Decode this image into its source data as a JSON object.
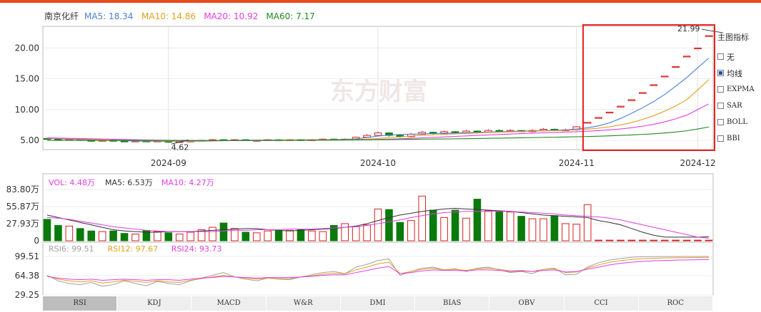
{
  "stock": {
    "name": "南京化纤",
    "ma": [
      {
        "label": "MA5: 18.34",
        "color": "#4a7fd6"
      },
      {
        "label": "MA10: 14.86",
        "color": "#e0a020"
      },
      {
        "label": "MA20: 10.92",
        "color": "#e23de2"
      },
      {
        "label": "MA60: 7.17",
        "color": "#1f8a1f"
      }
    ]
  },
  "watermark": "东方财富",
  "indicator_panel": {
    "title": "主图指标",
    "options": [
      {
        "label": "无",
        "checked": false
      },
      {
        "label": "均线",
        "checked": true
      },
      {
        "label": "EXPMA",
        "checked": false
      },
      {
        "label": "SAR",
        "checked": false
      },
      {
        "label": "BOLL",
        "checked": false
      },
      {
        "label": "BBI",
        "checked": false
      }
    ]
  },
  "bottom_tabs": [
    "RSI",
    "KDJ",
    "MACD",
    "W&R",
    "DMI",
    "BIAS",
    "OBV",
    "CCI",
    "ROC"
  ],
  "colors": {
    "up": "#d62020",
    "down": "#0a7a0a",
    "highlight": "#e8231b"
  },
  "chart_data": [
    {
      "type": "candlestick",
      "panel": "price",
      "ylim": [
        3.5,
        23.5
      ],
      "y_ticks": [
        "20.00",
        "15.00",
        "10.00",
        "5.00"
      ],
      "x_ticks": [
        {
          "label": "2024-09",
          "index": 11
        },
        {
          "label": "2024-10",
          "index": 30
        },
        {
          "label": "2024-11",
          "index": 48
        },
        {
          "label": "2024-12",
          "index": 59
        }
      ],
      "annotations": {
        "high_label": "21.99",
        "low_label": "4.62"
      },
      "candles": [
        [
          5.3,
          5.2,
          5.4,
          5.1
        ],
        [
          5.2,
          5.1,
          5.3,
          5.0
        ],
        [
          5.1,
          5.2,
          5.3,
          5.0
        ],
        [
          5.2,
          5.0,
          5.3,
          4.9
        ],
        [
          5.0,
          4.9,
          5.1,
          4.8
        ],
        [
          4.9,
          5.0,
          5.1,
          4.8
        ],
        [
          5.0,
          4.9,
          5.1,
          4.8
        ],
        [
          4.9,
          4.8,
          5.0,
          4.7
        ],
        [
          4.8,
          4.9,
          5.0,
          4.7
        ],
        [
          4.9,
          4.8,
          5.0,
          4.7
        ],
        [
          4.8,
          4.9,
          5.0,
          4.7
        ],
        [
          4.9,
          4.7,
          5.0,
          4.62
        ],
        [
          4.7,
          4.8,
          4.9,
          4.65
        ],
        [
          4.8,
          4.9,
          5.0,
          4.7
        ],
        [
          4.9,
          5.0,
          5.1,
          4.8
        ],
        [
          5.0,
          5.1,
          5.2,
          4.9
        ],
        [
          5.1,
          5.0,
          5.2,
          4.9
        ],
        [
          5.0,
          5.1,
          5.2,
          4.9
        ],
        [
          5.1,
          5.0,
          5.2,
          4.9
        ],
        [
          5.0,
          5.0,
          5.1,
          4.9
        ],
        [
          5.0,
          5.1,
          5.2,
          4.9
        ],
        [
          5.1,
          5.0,
          5.2,
          4.9
        ],
        [
          5.0,
          5.1,
          5.2,
          4.9
        ],
        [
          5.1,
          5.0,
          5.2,
          4.9
        ],
        [
          5.0,
          5.1,
          5.2,
          4.9
        ],
        [
          5.1,
          5.2,
          5.3,
          5.0
        ],
        [
          5.2,
          5.1,
          5.3,
          5.0
        ],
        [
          5.1,
          5.2,
          5.3,
          5.0
        ],
        [
          5.2,
          5.5,
          5.6,
          5.1
        ],
        [
          5.5,
          5.8,
          6.0,
          5.4
        ],
        [
          5.8,
          6.2,
          6.4,
          5.7
        ],
        [
          6.2,
          5.8,
          6.3,
          5.6
        ],
        [
          5.8,
          5.6,
          6.0,
          5.4
        ],
        [
          5.6,
          6.0,
          6.2,
          5.5
        ],
        [
          6.0,
          6.3,
          6.5,
          5.9
        ],
        [
          6.3,
          6.1,
          6.4,
          5.9
        ],
        [
          6.1,
          6.4,
          6.6,
          6.0
        ],
        [
          6.4,
          6.2,
          6.5,
          6.0
        ],
        [
          6.2,
          6.5,
          6.7,
          6.1
        ],
        [
          6.5,
          6.3,
          6.6,
          6.1
        ],
        [
          6.3,
          6.6,
          6.8,
          6.2
        ],
        [
          6.6,
          6.5,
          6.8,
          6.3
        ],
        [
          6.5,
          6.6,
          6.8,
          6.4
        ],
        [
          6.6,
          6.4,
          6.7,
          6.3
        ],
        [
          6.4,
          6.6,
          6.8,
          6.3
        ],
        [
          6.6,
          6.8,
          7.0,
          6.5
        ],
        [
          6.8,
          6.6,
          6.9,
          6.5
        ],
        [
          6.6,
          6.7,
          6.9,
          6.5
        ],
        [
          6.7,
          7.2,
          7.3,
          6.6
        ],
        [
          7.92,
          7.92,
          7.92,
          7.92
        ],
        [
          8.71,
          8.71,
          8.71,
          8.71
        ],
        [
          9.58,
          9.58,
          9.58,
          9.58
        ],
        [
          10.54,
          10.54,
          10.54,
          10.54
        ],
        [
          11.59,
          11.59,
          11.59,
          11.59
        ],
        [
          12.75,
          12.75,
          12.75,
          12.75
        ],
        [
          14.03,
          14.03,
          14.03,
          14.03
        ],
        [
          15.43,
          15.43,
          15.43,
          15.43
        ],
        [
          16.97,
          16.97,
          16.97,
          16.97
        ],
        [
          18.67,
          18.67,
          18.67,
          18.67
        ],
        [
          19.99,
          19.99,
          19.99,
          19.99
        ],
        [
          21.99,
          21.99,
          21.99,
          21.99
        ]
      ],
      "series": [
        {
          "name": "MA5",
          "color": "#4a7fd6",
          "values": [
            5.3,
            5.25,
            5.2,
            5.15,
            5.1,
            5.05,
            5.0,
            4.95,
            4.9,
            4.88,
            4.87,
            4.85,
            4.84,
            4.85,
            4.87,
            4.9,
            4.95,
            5.0,
            5.02,
            5.03,
            5.05,
            5.06,
            5.07,
            5.08,
            5.09,
            5.1,
            5.12,
            5.15,
            5.25,
            5.45,
            5.7,
            5.85,
            5.95,
            6.0,
            6.05,
            6.1,
            6.15,
            6.2,
            6.25,
            6.3,
            6.35,
            6.4,
            6.45,
            6.5,
            6.55,
            6.6,
            6.65,
            6.7,
            6.85,
            7.05,
            7.35,
            7.85,
            8.55,
            9.4,
            10.3,
            11.3,
            12.45,
            13.8,
            15.2,
            16.8,
            18.34
          ]
        },
        {
          "name": "MA10",
          "color": "#e0a020",
          "values": [
            5.35,
            5.3,
            5.25,
            5.2,
            5.15,
            5.1,
            5.06,
            5.02,
            4.98,
            4.95,
            4.93,
            4.91,
            4.9,
            4.9,
            4.91,
            4.92,
            4.94,
            4.96,
            4.98,
            5.0,
            5.02,
            5.04,
            5.05,
            5.06,
            5.07,
            5.08,
            5.09,
            5.1,
            5.13,
            5.2,
            5.3,
            5.45,
            5.58,
            5.7,
            5.8,
            5.9,
            5.98,
            6.05,
            6.12,
            6.2,
            6.27,
            6.33,
            6.38,
            6.43,
            6.48,
            6.53,
            6.57,
            6.62,
            6.7,
            6.82,
            6.98,
            7.2,
            7.5,
            7.9,
            8.4,
            9.0,
            9.75,
            10.6,
            11.6,
            13.2,
            14.86
          ]
        },
        {
          "name": "MA20",
          "color": "#e23de2",
          "values": [
            5.4,
            5.37,
            5.33,
            5.3,
            5.26,
            5.22,
            5.18,
            5.14,
            5.1,
            5.07,
            5.04,
            5.01,
            4.99,
            4.97,
            4.96,
            4.95,
            4.95,
            4.95,
            4.96,
            4.97,
            4.98,
            4.99,
            5.0,
            5.01,
            5.02,
            5.03,
            5.04,
            5.05,
            5.07,
            5.1,
            5.15,
            5.2,
            5.26,
            5.33,
            5.4,
            5.48,
            5.56,
            5.64,
            5.72,
            5.8,
            5.88,
            5.95,
            6.02,
            6.09,
            6.16,
            6.22,
            6.28,
            6.34,
            6.4,
            6.48,
            6.58,
            6.7,
            6.85,
            7.05,
            7.3,
            7.6,
            8.0,
            8.5,
            9.1,
            10.0,
            10.92
          ]
        },
        {
          "name": "MA60",
          "color": "#1f8a1f",
          "values": [
            5.0,
            5.0,
            5.0,
            5.0,
            5.0,
            5.0,
            5.0,
            5.0,
            5.0,
            4.99,
            4.99,
            4.99,
            4.98,
            4.98,
            4.98,
            4.98,
            4.98,
            4.98,
            4.99,
            4.99,
            4.99,
            5.0,
            5.0,
            5.01,
            5.02,
            5.03,
            5.04,
            5.05,
            5.07,
            5.09,
            5.11,
            5.13,
            5.15,
            5.17,
            5.19,
            5.21,
            5.23,
            5.25,
            5.27,
            5.3,
            5.33,
            5.36,
            5.39,
            5.42,
            5.45,
            5.48,
            5.51,
            5.54,
            5.58,
            5.62,
            5.67,
            5.73,
            5.8,
            5.88,
            5.97,
            6.07,
            6.2,
            6.35,
            6.55,
            6.85,
            7.17
          ]
        }
      ]
    },
    {
      "type": "bar",
      "panel": "volume",
      "unit": "万",
      "ylim": [
        0,
        83.8
      ],
      "y_ticks": [
        "83.80万",
        "55.87万",
        "27.93万",
        "0"
      ],
      "legend": [
        {
          "label": "VOL: 4.48万",
          "color": "#e23de2"
        },
        {
          "label": "MA5: 6.53万",
          "color": "#333333"
        },
        {
          "label": "MA10: 4.27万",
          "color": "#e23de2"
        }
      ],
      "values": [
        35,
        25,
        24,
        20,
        16,
        15,
        16,
        12,
        11,
        17,
        15,
        13,
        11,
        14,
        18,
        22,
        29,
        20,
        14,
        13,
        16,
        16,
        17,
        18,
        16,
        15,
        25,
        28,
        23,
        26,
        52,
        51,
        30,
        33,
        73,
        50,
        38,
        50,
        37,
        68,
        49,
        48,
        47,
        40,
        36,
        36,
        41,
        28,
        27,
        59,
        1,
        1,
        1,
        1,
        1,
        1,
        1,
        1,
        1,
        1,
        1
      ],
      "ma5": [
        42,
        38,
        34,
        30,
        26,
        22,
        18,
        16,
        15,
        14,
        14,
        15,
        15,
        15,
        16,
        17,
        18,
        19,
        20,
        20,
        18,
        17,
        16,
        17,
        18,
        19,
        20,
        22,
        24,
        28,
        33,
        38,
        42,
        45,
        48,
        50,
        52,
        53,
        52,
        51,
        50,
        49,
        48,
        46,
        44,
        42,
        41,
        40,
        39,
        38,
        33,
        30,
        26,
        20,
        14,
        9,
        6,
        6,
        6,
        6,
        6.53
      ],
      "ma10": [
        38,
        37,
        35,
        32,
        29,
        26,
        23,
        21,
        19,
        17,
        16,
        15,
        15,
        15,
        15,
        15,
        16,
        17,
        17,
        18,
        18,
        18,
        19,
        19,
        19,
        20,
        21,
        22,
        23,
        25,
        28,
        31,
        34,
        38,
        41,
        44,
        46,
        47,
        48,
        48,
        48,
        48,
        48,
        47,
        46,
        45,
        44,
        42,
        41,
        40,
        39,
        37,
        34,
        30,
        26,
        22,
        18,
        14,
        10,
        6,
        4.27
      ]
    },
    {
      "type": "line",
      "panel": "rsi",
      "ylim": [
        29.25,
        99.51
      ],
      "y_ticks": [
        "99.51",
        "64.38",
        "29.25"
      ],
      "series": [
        {
          "name": "RSI6",
          "label": "RSI6: 99.51",
          "color": "#a0a0a0",
          "values": [
            65,
            55,
            50,
            48,
            52,
            45,
            48,
            55,
            50,
            46,
            54,
            50,
            48,
            55,
            60,
            65,
            70,
            62,
            58,
            55,
            60,
            58,
            57,
            62,
            66,
            70,
            72,
            68,
            80,
            85,
            92,
            95,
            65,
            72,
            78,
            80,
            75,
            77,
            72,
            78,
            80,
            75,
            70,
            72,
            68,
            76,
            78,
            66,
            67,
            80,
            88,
            93,
            96,
            98,
            99,
            99.2,
            99.3,
            99.4,
            99.45,
            99.5,
            99.51
          ]
        },
        {
          "name": "RSI12",
          "label": "RSI12: 97.67",
          "color": "#e0a020",
          "values": [
            64,
            58,
            55,
            53,
            55,
            51,
            53,
            56,
            54,
            52,
            55,
            53,
            52,
            56,
            59,
            62,
            65,
            62,
            60,
            58,
            60,
            59,
            59,
            62,
            64,
            67,
            69,
            68,
            75,
            80,
            86,
            89,
            68,
            72,
            76,
            78,
            75,
            76,
            74,
            77,
            78,
            76,
            73,
            74,
            72,
            76,
            77,
            70,
            71,
            78,
            84,
            89,
            92,
            94,
            95.5,
            96.3,
            96.8,
            97.1,
            97.4,
            97.55,
            97.67
          ]
        },
        {
          "name": "RSI24",
          "label": "RSI24: 93.73",
          "color": "#e23de2",
          "values": [
            63,
            60,
            58,
            57,
            58,
            56,
            57,
            58,
            57,
            56,
            57,
            57,
            56,
            58,
            60,
            61,
            63,
            62,
            61,
            60,
            61,
            61,
            61,
            62,
            63,
            65,
            66,
            66,
            70,
            74,
            78,
            81,
            68,
            70,
            73,
            75,
            74,
            74,
            73,
            75,
            75,
            74,
            72,
            73,
            72,
            74,
            75,
            71,
            72,
            76,
            80,
            84,
            87,
            89,
            90.5,
            91.5,
            92.2,
            92.8,
            93.2,
            93.5,
            93.73
          ]
        }
      ]
    }
  ]
}
